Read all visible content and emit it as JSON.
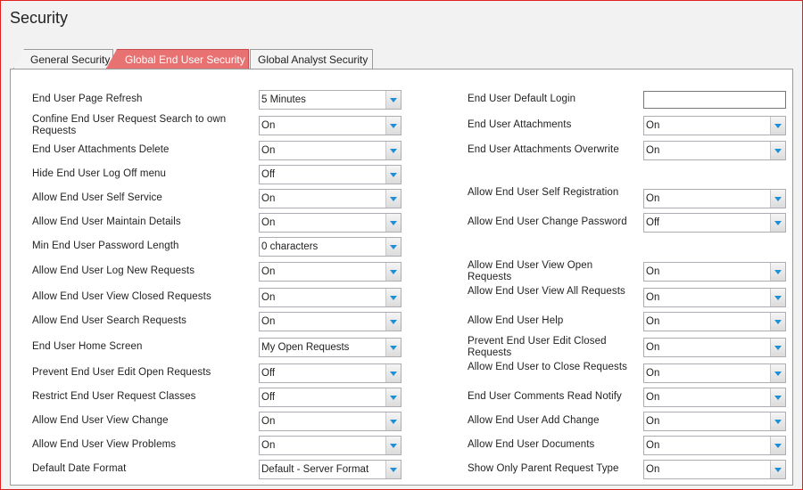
{
  "page": {
    "title": "Security"
  },
  "tabs": [
    {
      "label": "General Security"
    },
    {
      "label": "Global End User Security"
    },
    {
      "label": "Global Analyst Security"
    }
  ],
  "left": [
    {
      "label": "End User Page Refresh",
      "value": "5 Minutes"
    },
    {
      "label": "Confine End User Request Search to own Requests",
      "value": "On"
    },
    {
      "label": "End User Attachments Delete",
      "value": "On"
    },
    {
      "label": "Hide End User Log Off menu",
      "value": "Off"
    },
    {
      "label": "Allow End User Self Service",
      "value": "On"
    },
    {
      "label": "Allow End User Maintain Details",
      "value": "On"
    },
    {
      "label": "Min End User Password Length",
      "value": "0 characters"
    },
    {
      "label": "Allow End User Log New Requests",
      "value": "On"
    },
    {
      "label": "Allow End User View Closed Requests",
      "value": "On"
    },
    {
      "label": "Allow End User Search Requests",
      "value": "On"
    },
    {
      "label": "End User Home Screen",
      "value": "My Open Requests"
    },
    {
      "label": "Prevent End User Edit Open Requests",
      "value": "Off"
    },
    {
      "label": "Restrict End User Request Classes",
      "value": "Off"
    },
    {
      "label": "Allow End User View Change",
      "value": "On"
    },
    {
      "label": "Allow End User View Problems",
      "value": "On"
    },
    {
      "label": "Default Date Format",
      "value": "Default - Server Format"
    }
  ],
  "right": [
    {
      "label": "End User Default Login",
      "value": "",
      "kind": "text"
    },
    {
      "label": "End User Attachments",
      "value": "On"
    },
    {
      "label": "End User Attachments Overwrite",
      "value": "On"
    },
    null,
    {
      "label": "Allow End User Self Registration",
      "value": "On"
    },
    {
      "label": "Allow End User Change Password",
      "value": "Off"
    },
    null,
    {
      "label": "Allow End User View Open Requests",
      "value": "On"
    },
    {
      "label": "Allow End User View All Requests",
      "value": "On"
    },
    {
      "label": "Allow End User Help",
      "value": "On"
    },
    {
      "label": "Prevent End User Edit Closed Requests",
      "value": "On"
    },
    {
      "label": "Allow End User to Close Requests",
      "value": "On"
    },
    {
      "label": "End User Comments Read Notify",
      "value": "On"
    },
    {
      "label": "Allow End User Add Change",
      "value": "On"
    },
    {
      "label": "Allow End User Documents",
      "value": "On"
    },
    {
      "label": "Show Only Parent Request Type",
      "value": "On"
    }
  ]
}
